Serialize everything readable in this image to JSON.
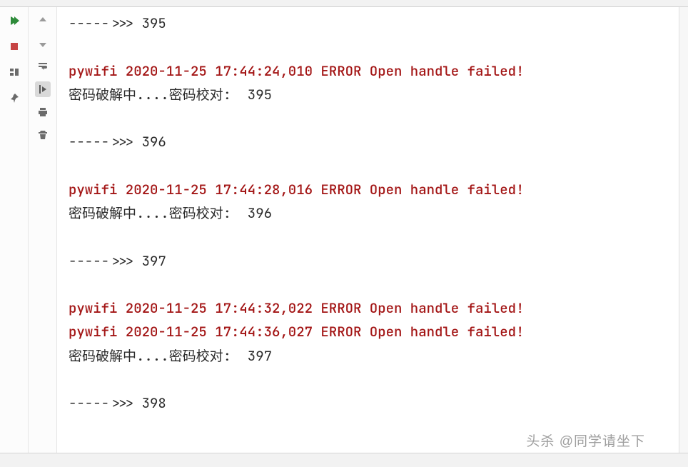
{
  "watermark": "头杀 @同学请坐下",
  "lines": [
    {
      "type": "text",
      "text": "----->>> 395"
    },
    {
      "type": "blank"
    },
    {
      "type": "error",
      "text": "pywifi 2020-11-25 17:44:24,010 ERROR Open handle failed!"
    },
    {
      "type": "text",
      "text": "密码破解中....密码校对:  395"
    },
    {
      "type": "blank"
    },
    {
      "type": "text",
      "text": "----->>> 396"
    },
    {
      "type": "blank"
    },
    {
      "type": "error",
      "text": "pywifi 2020-11-25 17:44:28,016 ERROR Open handle failed!"
    },
    {
      "type": "text",
      "text": "密码破解中....密码校对:  396"
    },
    {
      "type": "blank"
    },
    {
      "type": "text",
      "text": "----->>> 397"
    },
    {
      "type": "blank"
    },
    {
      "type": "error",
      "text": "pywifi 2020-11-25 17:44:32,022 ERROR Open handle failed!"
    },
    {
      "type": "error",
      "text": "pywifi 2020-11-25 17:44:36,027 ERROR Open handle failed!"
    },
    {
      "type": "text",
      "text": "密码破解中....密码校对:  397"
    },
    {
      "type": "blank"
    },
    {
      "type": "text",
      "text": "----->>> 398"
    }
  ]
}
